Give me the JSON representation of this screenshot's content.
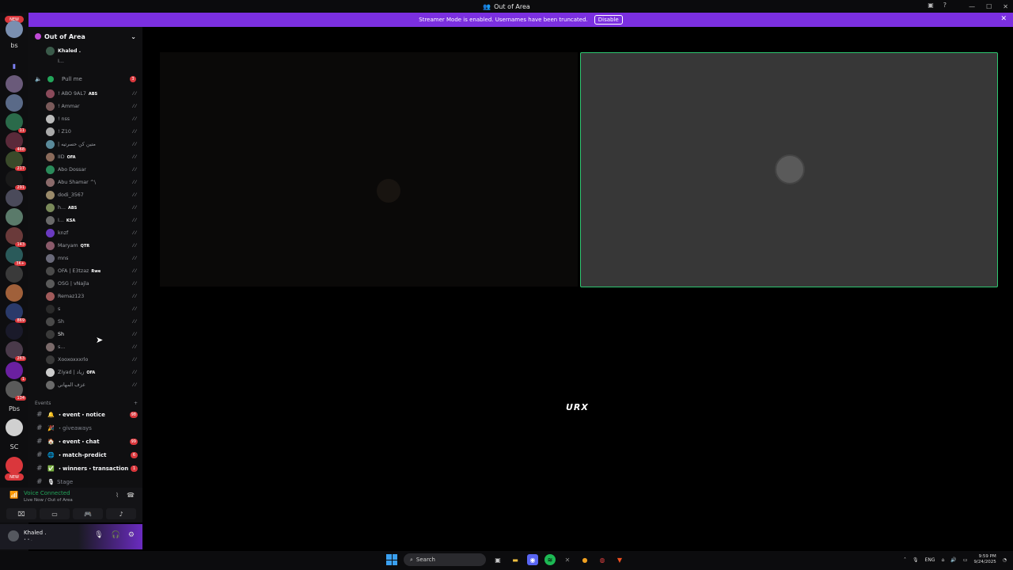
{
  "window": {
    "title": "Out of Area"
  },
  "banner": {
    "message": "Streamer Mode is enabled. Usernames have been truncated.",
    "button": "Disable"
  },
  "rail": {
    "new_top": "NEW",
    "bs": "bs",
    "pbs": "Pbs",
    "sc": "SC",
    "new_bottom": "NEW",
    "badges": [
      "11",
      "468",
      "217",
      "291",
      "143",
      "3K+",
      "869",
      "263",
      "1",
      "134"
    ]
  },
  "sidebar": {
    "server_name": "Out of Area",
    "top_user": "Khaled .",
    "top_user2": "I...",
    "voice_channel": {
      "name": "Pull me",
      "count": "3"
    },
    "members": [
      {
        "name": "! ABO 9AL7",
        "tag": "ABS"
      },
      {
        "name": "! Ammar",
        "tag": ""
      },
      {
        "name": "! nss",
        "tag": ""
      },
      {
        "name": "! Z10",
        "tag": ""
      },
      {
        "name": "| متين كن حسرتيه",
        "tag": ""
      },
      {
        "name": "IID",
        "tag": "OFA"
      },
      {
        "name": "Abo Dossar",
        "tag": ""
      },
      {
        "name": "Abu Shamar ^\\",
        "tag": ""
      },
      {
        "name": "dodi_3567",
        "tag": ""
      },
      {
        "name": "h...",
        "tag": "ABS"
      },
      {
        "name": "I...",
        "tag": "KSA"
      },
      {
        "name": "knzf",
        "tag": ""
      },
      {
        "name": "Maryam",
        "tag": "QTR"
      },
      {
        "name": "mns",
        "tag": ""
      },
      {
        "name": "OFA | E3tzaz",
        "tag": "Rwe"
      },
      {
        "name": "OSG | vNajla",
        "tag": ""
      },
      {
        "name": "Remaz123",
        "tag": ""
      },
      {
        "name": "s",
        "tag": ""
      },
      {
        "name": "Sh",
        "tag": ""
      },
      {
        "name": "Sh",
        "tag": ""
      },
      {
        "name": "s...",
        "tag": ""
      },
      {
        "name": "Xooxoxxxrlo",
        "tag": ""
      },
      {
        "name": "Ziyad | زياد",
        "tag": "OFA"
      },
      {
        "name": "عزف المهاني",
        "tag": ""
      }
    ],
    "category": "Events",
    "channels": [
      {
        "name": "・event・notice",
        "badge": "98"
      },
      {
        "name": "・giveaways",
        "badge": ""
      },
      {
        "name": "・event・chat",
        "badge": "99"
      },
      {
        "name": "・match-predict",
        "badge": "6"
      },
      {
        "name": "・winners・transaction",
        "badge": "1"
      },
      {
        "name": "Stage",
        "badge": ""
      }
    ]
  },
  "voice": {
    "status": "Voice Connected",
    "location": "Live Now / Out of Area"
  },
  "user": {
    "name": "Khaled .",
    "sub": "• • ."
  },
  "stage": {
    "logo": "URX"
  },
  "taskbar": {
    "search": "Search",
    "lang": "ENG",
    "time": "9:59 PM",
    "date": "9/24/2025"
  }
}
